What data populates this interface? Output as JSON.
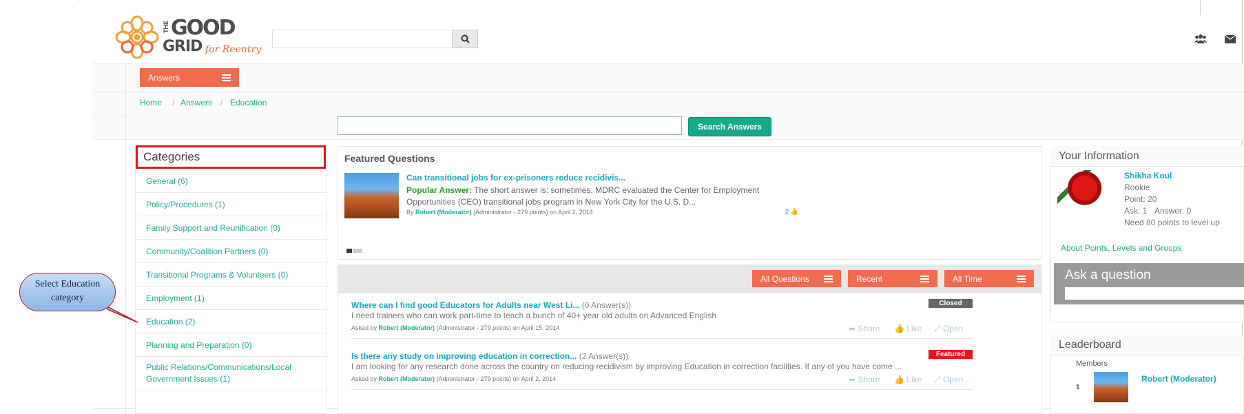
{
  "logo": {
    "the": "THE",
    "good": "GOOD",
    "grid": "GRID",
    "tagline": "for Reentry"
  },
  "header": {
    "search_placeholder": "",
    "icons": [
      "search-icon",
      "group-icon",
      "envelope-icon"
    ]
  },
  "section_menu": {
    "label": "Answers"
  },
  "breadcrumb": [
    "Home",
    "Answers",
    "Education"
  ],
  "answers_search": {
    "value": "",
    "button": "Search Answers"
  },
  "categories": {
    "title": "Categories",
    "items": [
      "General (6)",
      "Policy/Procedures (1)",
      "Family Support and Reunification (0)",
      "Community/Coalition Partners (0)",
      "Transitional Programs & Volunteers (0)",
      "Employment (1)",
      "Education (2)",
      "Planning and Preparation (0)",
      "Public Relations/Communications/Local Government Issues (1)"
    ]
  },
  "callout": {
    "text": "Select Education category"
  },
  "featured": {
    "title": "Featured Questions",
    "question": "Can transitional jobs for ex-prisoners reduce recidivis...",
    "popular_label": "Popular Answer:",
    "answer": "The short answer is: sometimes. MDRC evaluated the Center for Employment Opportunities (CEO) transitional jobs program in New York City for the U.S. D...",
    "by": "By",
    "author": "Robert (Moderator)",
    "author_meta": "(Administrator - 279 points)  on April 2, 2014",
    "likes": "2"
  },
  "filters": {
    "all": "All Questions",
    "recent": "Recent",
    "time": "All Time"
  },
  "questions": [
    {
      "title": "Where can I find good Educators for Adults near West Li...",
      "answers": "(0 Answer(s))",
      "badge": "Closed",
      "body": "I need trainers who can work part-time to teach a bunch of 40+ year old adults on Advanced English",
      "asked_by": "Asked by",
      "author": "Robert (Moderator)",
      "meta": "(Administrator - 279 points) on April 15, 2014"
    },
    {
      "title": "Is there any study on improving education in correction...",
      "answers": "(2 Answer(s))",
      "badge": "Featured",
      "body": "I am looking for any research done across the country on reducing recidivism by improving Education in correction facilities. If any of you have come ...",
      "asked_by": "Asked by",
      "author": "Robert (Moderator)",
      "meta": "(Administrator - 279 points) on April 2, 2014"
    }
  ],
  "actions": {
    "share": "Share",
    "like": "Like",
    "open": "Open"
  },
  "your_info": {
    "title": "Your Information",
    "name": "Shikha Koul",
    "level": "Rookie",
    "points": "Point: 20",
    "ask": "Ask: 1",
    "answer": "Answer: 0",
    "next": "Need 80 points to level up",
    "link": "About Points, Levels and Groups"
  },
  "ask_box": {
    "title": "Ask a question"
  },
  "leaderboard": {
    "title": "Leaderboard",
    "members": "Members",
    "rank": "1",
    "name": "Robert (Moderator)"
  },
  "colors": {
    "accent": "#f26b4f",
    "teal": "#16a887",
    "link": "#2aaa8a",
    "closed": "#666666",
    "featured": "#e8151b"
  }
}
